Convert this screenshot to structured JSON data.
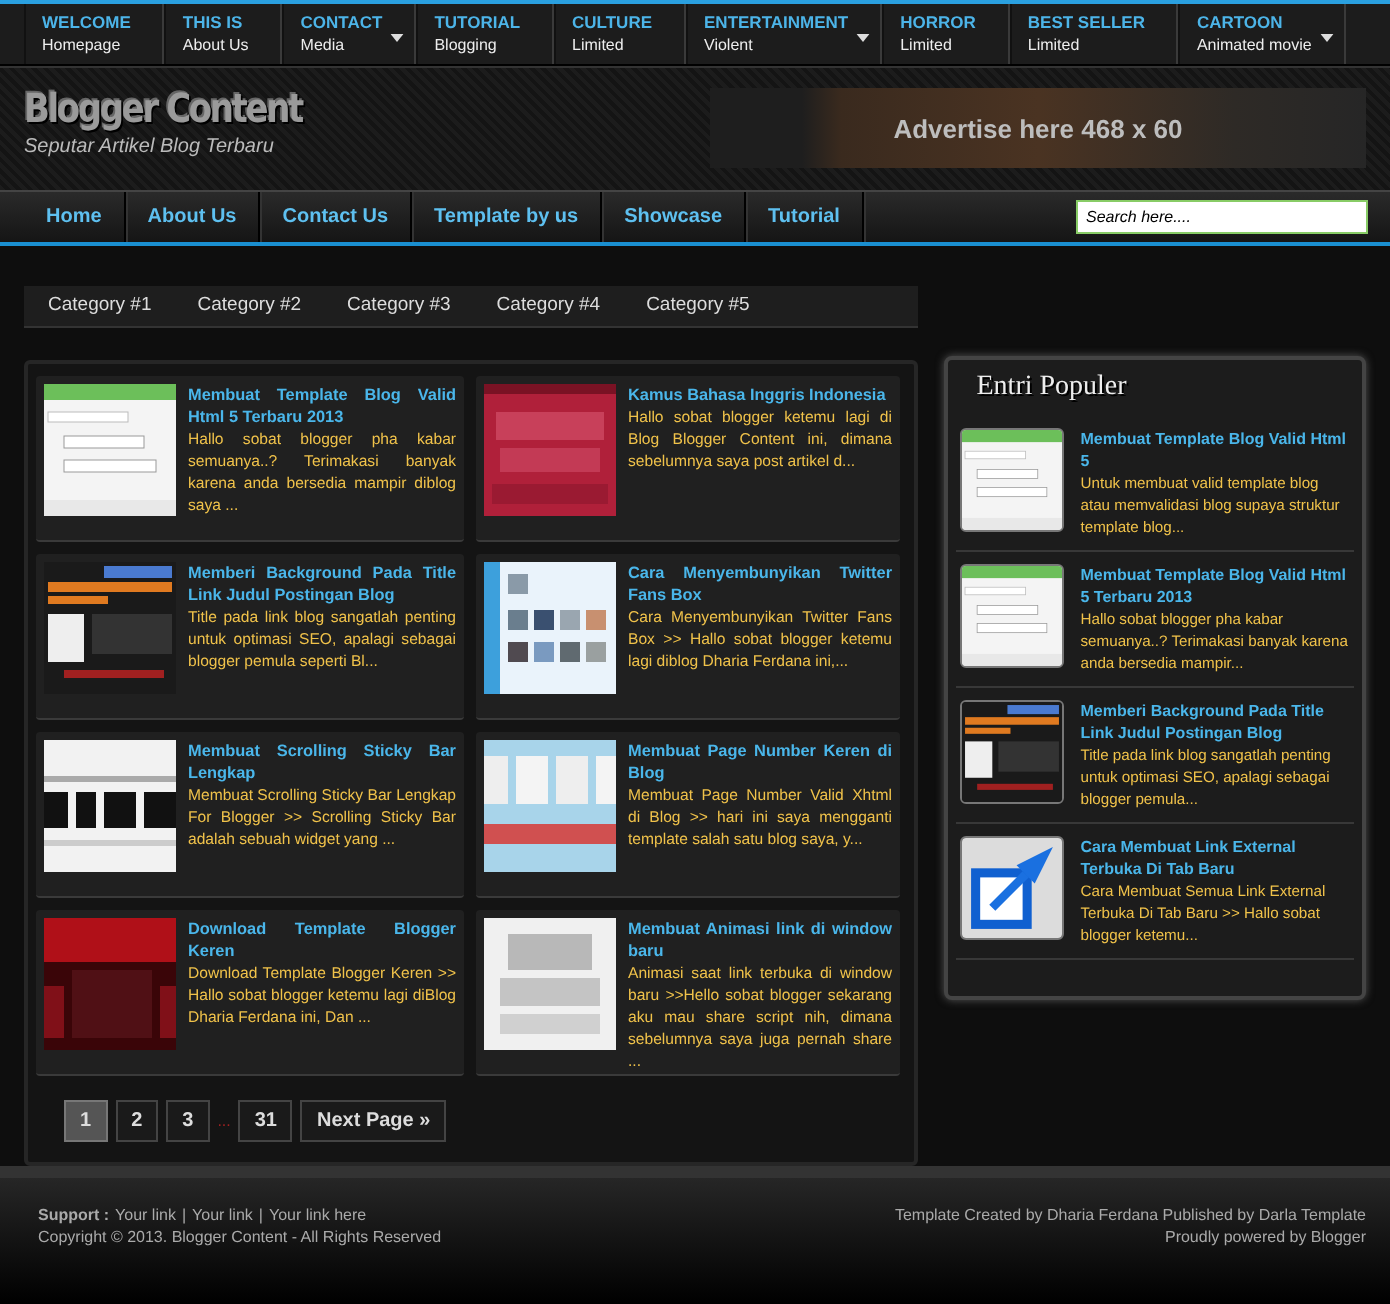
{
  "top_menu": [
    {
      "title": "WELCOME",
      "subtitle": "Homepage",
      "has_dropdown": false
    },
    {
      "title": "THIS IS",
      "subtitle": "About Us",
      "has_dropdown": false
    },
    {
      "title": "CONTACT",
      "subtitle": "Media",
      "has_dropdown": true
    },
    {
      "title": "TUTORIAL",
      "subtitle": "Blogging",
      "has_dropdown": false
    },
    {
      "title": "CULTURE",
      "subtitle": "Limited",
      "has_dropdown": false
    },
    {
      "title": "ENTERTAINMENT",
      "subtitle": "Violent",
      "has_dropdown": true
    },
    {
      "title": "HORROR",
      "subtitle": "Limited",
      "has_dropdown": false
    },
    {
      "title": "BEST SELLER",
      "subtitle": "Limited",
      "has_dropdown": false
    },
    {
      "title": "CARTOON",
      "subtitle": "Animated movie",
      "has_dropdown": true
    }
  ],
  "header": {
    "title": "Blogger Content",
    "tagline": "Seputar Artikel Blog Terbaru",
    "ad_text": "Advertise here 468 x 60"
  },
  "main_menu": [
    "Home",
    "About Us",
    "Contact Us",
    "Template by us",
    "Showcase",
    "Tutorial"
  ],
  "search": {
    "placeholder": "Search here...."
  },
  "categories": [
    "Category #1",
    "Category #2",
    "Category #3",
    "Category #4",
    "Category #5"
  ],
  "posts": [
    {
      "title": "Membuat Template Blog Valid Html 5 Terbaru 2013",
      "excerpt": "Hallo sobat blogger pha kabar semuanya..? Terimakasi banyak karena anda bersedia mampir diblog saya ..."
    },
    {
      "title": "Kamus Bahasa Inggris Indonesia",
      "excerpt": "Hallo sobat blogger ketemu lagi di Blog Blogger Content ini, dimana sebelumnya saya post artikel d..."
    },
    {
      "title": "Memberi Background Pada Title Link Judul Postingan Blog",
      "excerpt": "Title pada link blog sangatlah penting untuk optimasi SEO, apalagi sebagai blogger pemula seperti Bl..."
    },
    {
      "title": "Cara Menyembunyikan Twitter Fans Box",
      "excerpt": "Cara Menyembunyikan Twitter Fans Box >> Hallo sobat blogger ketemu lagi diblog Dharia Ferdana ini,..."
    },
    {
      "title": "Membuat Scrolling Sticky Bar Lengkap",
      "excerpt": "Membuat Scrolling Sticky Bar Lengkap For Blogger >> Scrolling Sticky Bar adalah sebuah widget yang ..."
    },
    {
      "title": "Membuat Page Number Keren di Blog",
      "excerpt": "Membuat Page Number Valid Xhtml di Blog >> hari ini saya mengganti template salah satu blog saya, y..."
    },
    {
      "title": "Download Template Blogger Keren",
      "excerpt": "Download Template Blogger Keren >> Hallo sobat blogger ketemu lagi diBlog Dharia Ferdana ini, Dan ..."
    },
    {
      "title": "Membuat Animasi link di window baru",
      "excerpt": "Animasi saat link terbuka di window baru >>Hello sobat blogger sekarang aku mau share script nih, dimana sebelumnya saya juga pernah share ..."
    }
  ],
  "pagination": {
    "pages": [
      {
        "label": "1",
        "selected": true
      },
      {
        "label": "2",
        "selected": false
      },
      {
        "label": "3",
        "selected": false
      },
      {
        "label": "...",
        "kind": "gap"
      },
      {
        "label": "31",
        "selected": false
      }
    ],
    "next": "Next Page »"
  },
  "sidebar": {
    "title": "Entri Populer",
    "items": [
      {
        "title": "Membuat Template Blog Valid Html 5",
        "excerpt": "Untuk membuat valid template blog atau memvalidasi blog supaya struktur template blog..."
      },
      {
        "title": "Membuat Template Blog Valid Html 5 Terbaru 2013",
        "excerpt": "Hallo sobat blogger pha kabar semuanya..? Terimakasi banyak karena anda bersedia mampir..."
      },
      {
        "title": "Memberi Background Pada Title Link Judul Postingan Blog",
        "excerpt": "Title pada link blog sangatlah penting untuk optimasi SEO, apalagi sebagai blogger pemula..."
      },
      {
        "title": "Cara Membuat Link External Terbuka Di Tab Baru",
        "excerpt": "Cara Membuat Semua Link External Terbuka Di Tab Baru >> Hallo sobat blogger ketemu..."
      }
    ]
  },
  "footer": {
    "support_label": "Support :",
    "support_links": [
      "Your link",
      "Your link",
      "Your link here"
    ],
    "separator": "|",
    "copyright": "Copyright © 2013. Blogger Content - All Rights Reserved",
    "credits": "Template Created by Dharia Ferdana Published by Darla Template",
    "powered": "Proudly powered by Blogger"
  }
}
